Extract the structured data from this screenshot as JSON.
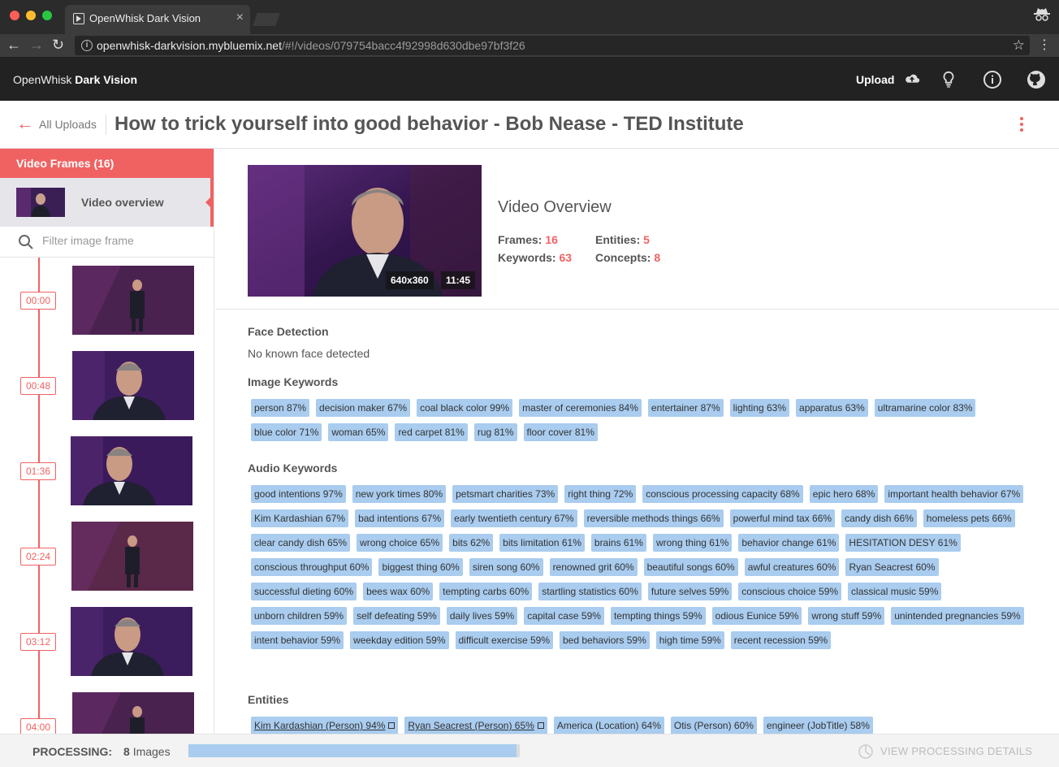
{
  "browser": {
    "tab_title": "OpenWhisk Dark Vision",
    "tab_close": "×",
    "url_host": "openwhisk-darkvision.mybluemix.net",
    "url_path": "/#!/videos/079754bacc4f92998d630dbe97bf3f26"
  },
  "app": {
    "brand_prefix": "OpenWhisk",
    "brand_name": "Dark Vision",
    "upload_label": "Upload"
  },
  "page": {
    "back_label": "All Uploads",
    "title": "How to trick yourself into good behavior - Bob Nease - TED Institute"
  },
  "sidebar": {
    "header": "Video Frames (16)",
    "overview_label": "Video overview",
    "filter_placeholder": "Filter image frame",
    "frames": [
      "00:00",
      "00:48",
      "01:36",
      "02:24",
      "03:12",
      "04:00"
    ]
  },
  "overview": {
    "resolution": "640x360",
    "duration": "11:45",
    "title": "Video Overview",
    "frames_label": "Frames:",
    "frames_value": "16",
    "entities_label": "Entities:",
    "entities_value": "5",
    "keywords_label": "Keywords:",
    "keywords_value": "63",
    "concepts_label": "Concepts:",
    "concepts_value": "8"
  },
  "face_detection": {
    "heading": "Face Detection",
    "text": "No known face detected"
  },
  "image_keywords": {
    "heading": "Image Keywords",
    "tags": [
      "person 87%",
      "decision maker 67%",
      "coal black color 99%",
      "master of ceremonies 84%",
      "entertainer 87%",
      "lighting 63%",
      "apparatus 63%",
      "ultramarine color 83%",
      "blue color 71%",
      "woman 65%",
      "red carpet 81%",
      "rug 81%",
      "floor cover 81%"
    ]
  },
  "audio_keywords": {
    "heading": "Audio Keywords",
    "tags": [
      "good intentions 97%",
      "new york times 80%",
      "petsmart charities 73%",
      "right thing 72%",
      "conscious processing capacity 68%",
      "epic hero 68%",
      "important health behavior 67%",
      "Kim Kardashian 67%",
      "bad intentions 67%",
      "early twentieth century 67%",
      "reversible methods things 66%",
      "powerful mind tax 66%",
      "candy dish 66%",
      "homeless pets 66%",
      "clear candy dish 65%",
      "wrong choice 65%",
      "bits 62%",
      "bits limitation 61%",
      "brains 61%",
      "wrong thing 61%",
      "behavior change 61%",
      "HESITATION DESY 61%",
      "conscious throughput 60%",
      "biggest thing 60%",
      "siren song 60%",
      "renowned grit 60%",
      "beautiful songs 60%",
      "awful creatures 60%",
      "Ryan Seacrest 60%",
      "successful dieting 60%",
      "bees wax 60%",
      "tempting carbs 60%",
      "startling statistics 60%",
      "future selves 59%",
      "conscious choice 59%",
      "classical music 59%",
      "unborn children 59%",
      "self defeating 59%",
      "daily lives 59%",
      "capital case 59%",
      "tempting things 59%",
      "odious Eunice 59%",
      "wrong stuff 59%",
      "unintended pregnancies 59%",
      "intent behavior 59%",
      "weekday edition 59%",
      "difficult exercise 59%",
      "bed behaviors 59%",
      "high time 59%",
      "recent recession 59%"
    ]
  },
  "entities": {
    "heading": "Entities",
    "tags": [
      {
        "label": "Kim Kardashian (Person) 94%",
        "link": true
      },
      {
        "label": "Ryan Seacrest (Person) 65%",
        "link": true
      },
      {
        "label": "America (Location) 64%",
        "link": false
      },
      {
        "label": "Otis (Person) 60%",
        "link": false
      },
      {
        "label": "engineer (JobTitle) 58%",
        "link": false
      }
    ]
  },
  "footer": {
    "processing_label": "PROCESSING:",
    "count": "8",
    "count_unit": "Images",
    "progress": 0.99,
    "details_label": "VIEW PROCESSING DETAILS"
  },
  "colors": {
    "accent": "#f06262",
    "tag": "#a9ccef",
    "header_bg": "#222222"
  }
}
